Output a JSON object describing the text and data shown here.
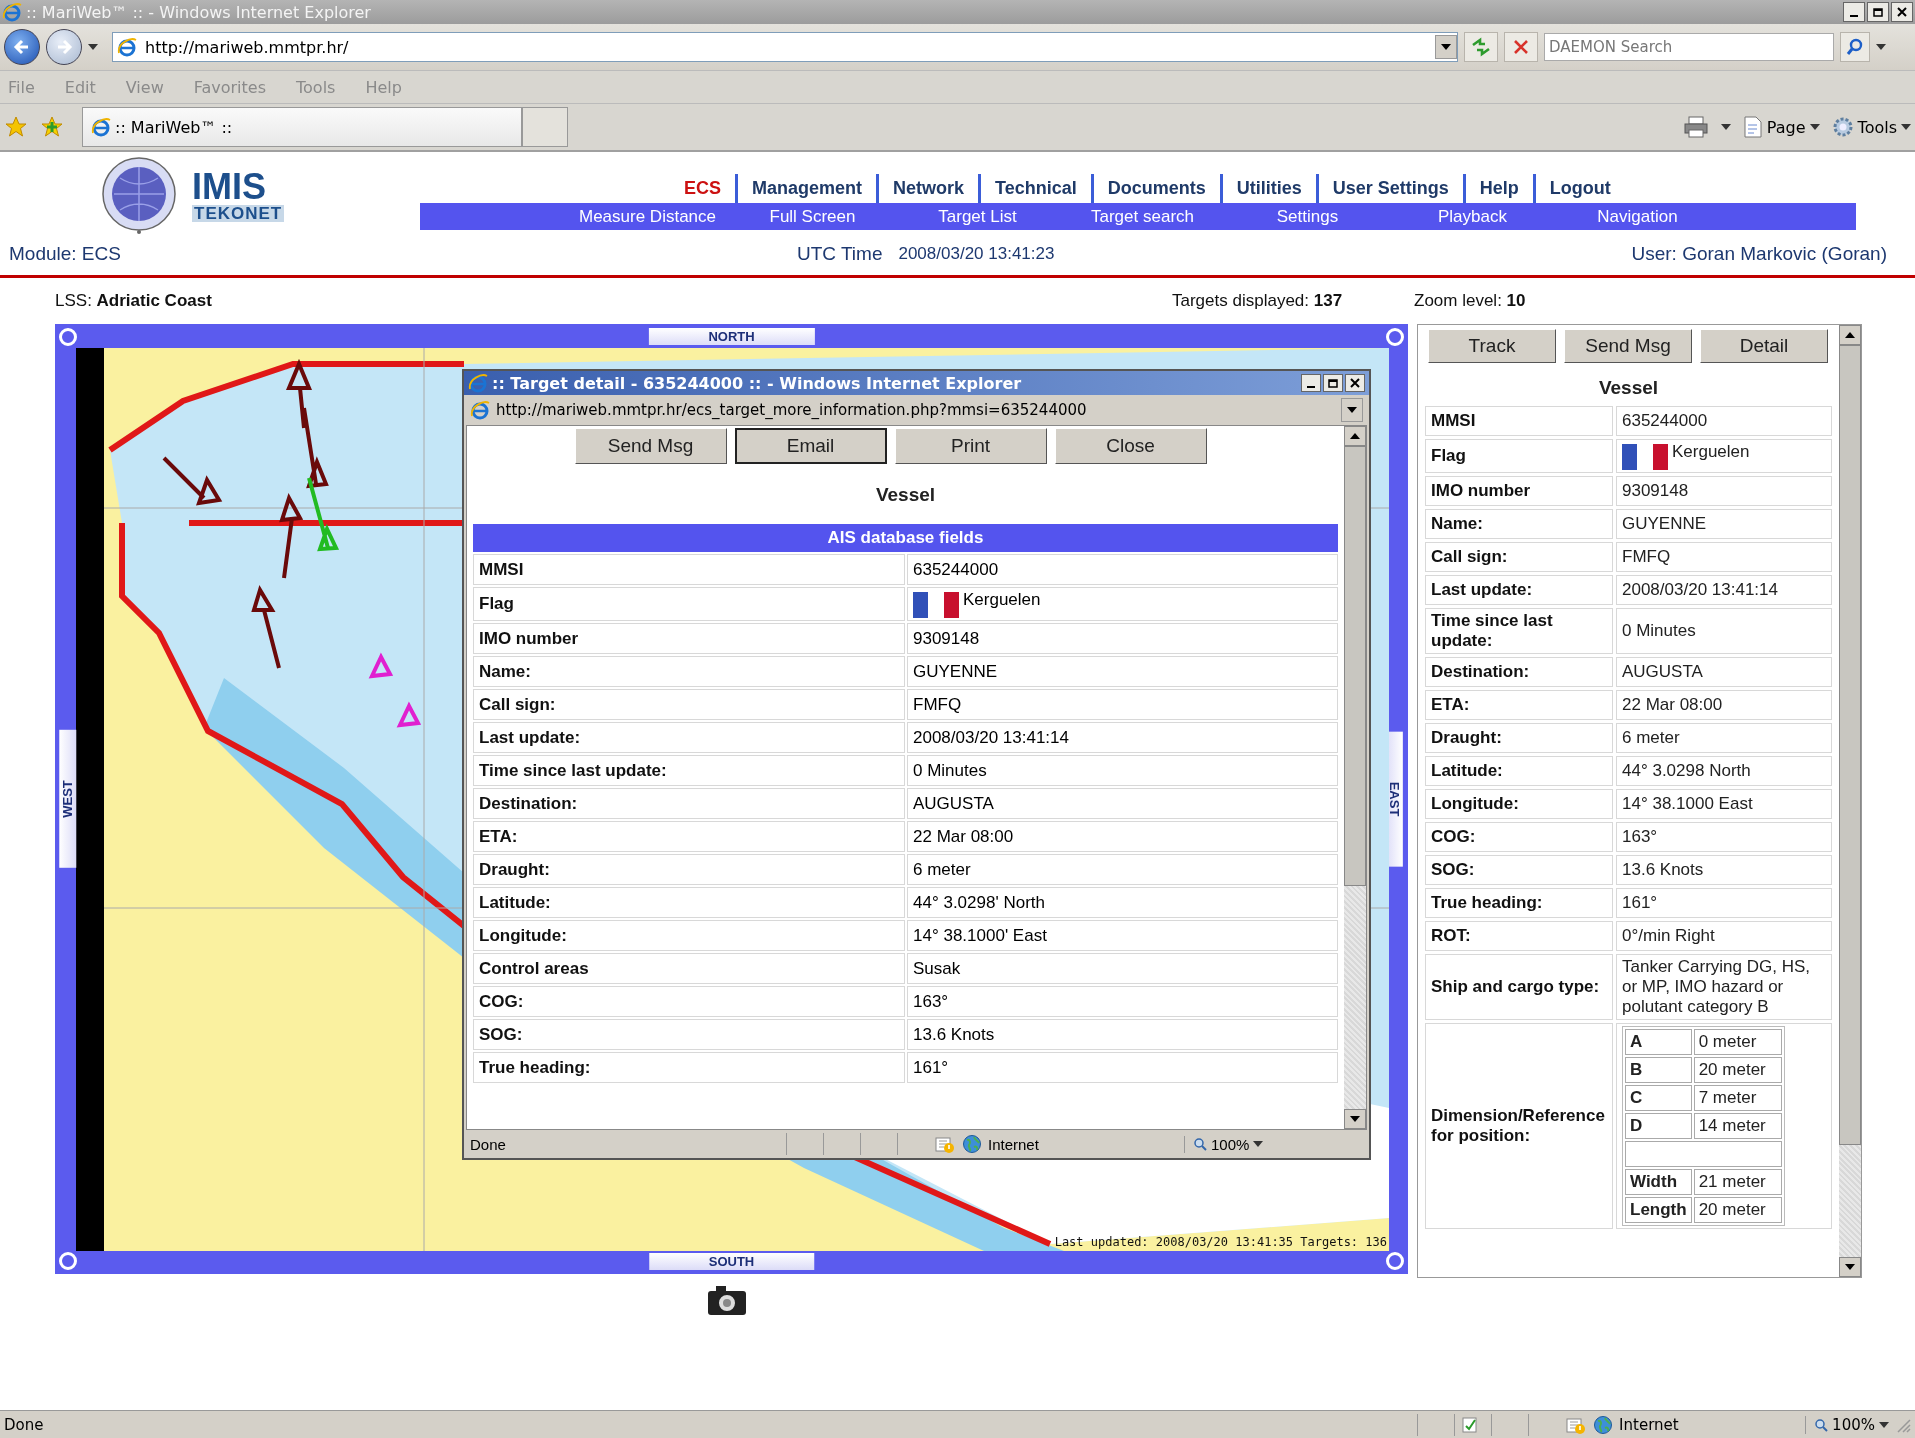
{
  "browser": {
    "title": ":: MariWeb™ :: - Windows Internet Explorer",
    "url": "http://mariweb.mmtpr.hr/",
    "search": {
      "placeholder": "DAEMON Search"
    },
    "menu": [
      "File",
      "Edit",
      "View",
      "Favorites",
      "Tools",
      "Help"
    ],
    "tab_title": ":: MariWeb™ ::",
    "commands": [
      "Page",
      "Tools"
    ],
    "status": "Done",
    "zone": "Internet",
    "zoom": "100%"
  },
  "header": {
    "logo": "IMIS",
    "logo_sub": "TEKONET",
    "nav": [
      {
        "label": "ECS",
        "selected": true
      },
      {
        "label": "Management",
        "selected": false
      },
      {
        "label": "Network",
        "selected": false
      },
      {
        "label": "Technical",
        "selected": false
      },
      {
        "label": "Documents",
        "selected": false
      },
      {
        "label": "Utilities",
        "selected": false
      },
      {
        "label": "User Settings",
        "selected": false
      },
      {
        "label": "Help",
        "selected": false
      },
      {
        "label": "Logout",
        "selected": false
      }
    ],
    "subnav": [
      "Measure Distance",
      "Full Screen",
      "Target List",
      "Target search",
      "Settings",
      "Playback",
      "Navigation"
    ],
    "module": "Module: ECS",
    "utc_label": "UTC Time",
    "utc_value": "2008/03/20 13:41:23",
    "user": "User: Goran Markovic (Goran)",
    "lss_label": "LSS:",
    "lss_value": "Adriatic Coast",
    "targets_label": "Targets displayed:",
    "targets_value": "137",
    "zoom_label": "Zoom level:",
    "zoom_value": "10"
  },
  "map": {
    "north": "NORTH",
    "south": "SOUTH",
    "west": "WEST",
    "east": "EAST",
    "footer": "Last updated: 2008/03/20 13:41:35 Targets: 136"
  },
  "popup": {
    "title": ":: Target detail - 635244000 :: - Windows Internet Explorer",
    "url": "http://mariweb.mmtpr.hr/ecs_target_more_information.php?mmsi=635244000",
    "buttons": [
      {
        "label": "Send Msg",
        "selected": false
      },
      {
        "label": "Email",
        "selected": true
      },
      {
        "label": "Print",
        "selected": false
      },
      {
        "label": "Close",
        "selected": false
      }
    ],
    "heading": "Vessel",
    "table_title": "AIS database fields",
    "rows": [
      {
        "kind": "text",
        "label": "MMSI",
        "value": "635244000"
      },
      {
        "kind": "flag",
        "label": "Flag",
        "value": "Kerguelen"
      },
      {
        "kind": "text",
        "label": "IMO number",
        "value": "9309148"
      },
      {
        "kind": "text",
        "label": "Name:",
        "value": "GUYENNE"
      },
      {
        "kind": "text",
        "label": "Call sign:",
        "value": "FMFQ"
      },
      {
        "kind": "text",
        "label": "Last update:",
        "value": "2008/03/20 13:41:14"
      },
      {
        "kind": "text",
        "label": "Time since last update:",
        "value": "0 Minutes"
      },
      {
        "kind": "text",
        "label": "Destination:",
        "value": "AUGUSTA"
      },
      {
        "kind": "text",
        "label": "ETA:",
        "value": "22 Mar 08:00"
      },
      {
        "kind": "text",
        "label": "Draught:",
        "value": "6 meter"
      },
      {
        "kind": "text",
        "label": "Latitude:",
        "value": "44° 3.0298' North"
      },
      {
        "kind": "text",
        "label": "Longitude:",
        "value": "14° 38.1000' East"
      },
      {
        "kind": "text",
        "label": "Control areas",
        "value": "Susak"
      },
      {
        "kind": "text",
        "label": "COG:",
        "value": "163°"
      },
      {
        "kind": "text",
        "label": "SOG:",
        "value": "13.6 Knots"
      },
      {
        "kind": "text",
        "label": "True heading:",
        "value": "161°"
      }
    ],
    "status": "Done",
    "zone": "Internet",
    "zoom": "100%"
  },
  "panel": {
    "buttons": [
      "Track",
      "Send Msg",
      "Detail"
    ],
    "heading": "Vessel",
    "rows": [
      {
        "kind": "text",
        "label": "MMSI",
        "value": "635244000"
      },
      {
        "kind": "flag",
        "label": "Flag",
        "value": "Kerguelen"
      },
      {
        "kind": "text",
        "label": "IMO number",
        "value": "9309148"
      },
      {
        "kind": "text",
        "label": "Name:",
        "value": "GUYENNE"
      },
      {
        "kind": "text",
        "label": "Call sign:",
        "value": "FMFQ"
      },
      {
        "kind": "text",
        "label": "Last update:",
        "value": "2008/03/20 13:41:14"
      },
      {
        "kind": "text",
        "label": "Time since last update:",
        "value": "0 Minutes"
      },
      {
        "kind": "text",
        "label": "Destination:",
        "value": "AUGUSTA"
      },
      {
        "kind": "text",
        "label": "ETA:",
        "value": "22 Mar 08:00"
      },
      {
        "kind": "text",
        "label": "Draught:",
        "value": "6 meter"
      },
      {
        "kind": "text",
        "label": "Latitude:",
        "value": "44° 3.0298 North"
      },
      {
        "kind": "text",
        "label": "Longitude:",
        "value": "14° 38.1000 East"
      },
      {
        "kind": "text",
        "label": "COG:",
        "value": "163°"
      },
      {
        "kind": "text",
        "label": "SOG:",
        "value": "13.6 Knots"
      },
      {
        "kind": "text",
        "label": "True heading:",
        "value": "161°"
      },
      {
        "kind": "text",
        "label": "ROT:",
        "value": "0°/min Right"
      },
      {
        "kind": "text",
        "label": "Ship and cargo type:",
        "value": "Tanker Carrying DG, HS, or MP, IMO hazard or polutant category B"
      },
      {
        "kind": "dimensions",
        "label": "Dimension/Reference for position:",
        "offsets": [
          {
            "label": "A",
            "value": "0 meter"
          },
          {
            "label": "B",
            "value": "20 meter"
          },
          {
            "label": "C",
            "value": "7 meter"
          },
          {
            "label": "D",
            "value": "14 meter"
          }
        ],
        "size": [
          {
            "label": "Width",
            "value": "21 meter"
          },
          {
            "label": "Length",
            "value": "20 meter"
          }
        ]
      }
    ]
  }
}
